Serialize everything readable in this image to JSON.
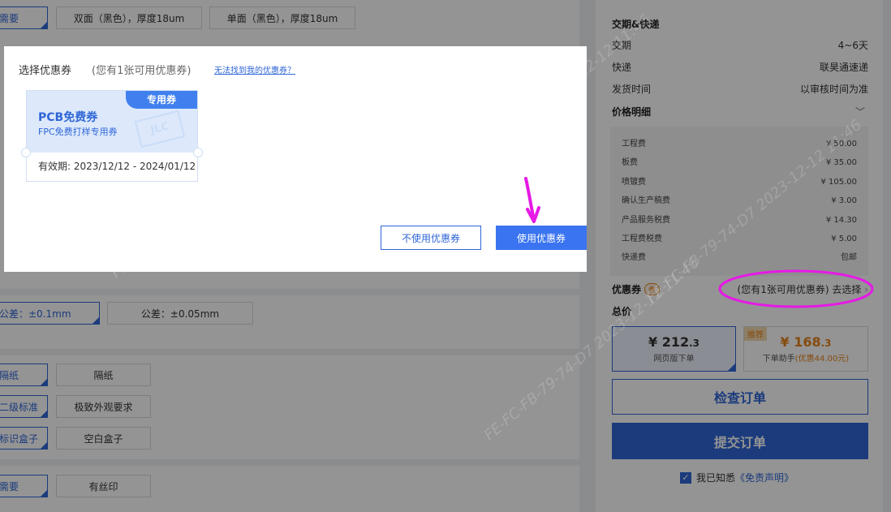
{
  "left": {
    "options": [
      {
        "label": "需要",
        "selected": true
      },
      {
        "label": "双面（黑色），厚度18um",
        "selected": false
      },
      {
        "label": "单面（黑色），厚度18um",
        "selected": false
      },
      {
        "label": "公差：±0.1mm",
        "selected": true
      },
      {
        "label": "公差：±0.05mm",
        "selected": false
      },
      {
        "label": "隔纸",
        "selected": true
      },
      {
        "label": "隔纸",
        "selected": false
      },
      {
        "label": "二级标准",
        "selected": true
      },
      {
        "label": "极致外观要求",
        "selected": false
      },
      {
        "label": "标识盒子",
        "selected": true
      },
      {
        "label": "空白盒子",
        "selected": false
      },
      {
        "label": "需要",
        "selected": true
      },
      {
        "label": "有丝印",
        "selected": false
      }
    ]
  },
  "sidebar": {
    "delivery_title": "交期&快递",
    "rows": [
      {
        "label": "交期",
        "value": "4~6天"
      },
      {
        "label": "快递",
        "value": "联昊通速递"
      },
      {
        "label": "发货时间",
        "value": "以审核时间为准"
      }
    ],
    "price_title": "价格明细",
    "price_items": [
      {
        "label": "工程费",
        "value": "¥ 50.00"
      },
      {
        "label": "板费",
        "value": "¥ 35.00"
      },
      {
        "label": "喷镀费",
        "value": "¥ 105.00"
      },
      {
        "label": "确认生产稿费",
        "value": "¥ 3.00"
      },
      {
        "label": "产品服务税费",
        "value": "¥ 14.30"
      },
      {
        "label": "工程费税费",
        "value": "¥ 5.00"
      },
      {
        "label": "快递费",
        "value": "包邮"
      }
    ],
    "coupon_label": "优惠券",
    "coupon_badge": "券",
    "coupon_choose": "(您有1张可用优惠券) 去选择",
    "total_label": "总价",
    "web_price_main": "¥ 212",
    "web_price_decimal": ".3",
    "web_price_desc": "网页版下单",
    "assist_badge": "推荐",
    "assist_price_main": "¥ 168",
    "assist_price_decimal": ".3",
    "assist_desc": "下单助手",
    "assist_discount": "(优惠44.00元)",
    "check_order": "检查订单",
    "submit_order": "提交订单",
    "agree_text": "我已知悉",
    "agree_link": "《免责声明》"
  },
  "dialog": {
    "title": "选择优惠券",
    "count": "(您有1张可用优惠券)",
    "help_link": "无法找到我的优惠券？",
    "coupon": {
      "tag": "专用券",
      "name": "PCB免费券",
      "desc": "FPC免费打样专用券",
      "logo": "JLC",
      "valid": "有效期: 2023/12/12 - 2024/01/12"
    },
    "no_use_button": "不使用优惠券",
    "use_button": "使用优惠券"
  },
  "watermark": "FE-FC-FB-79-74-D7  2023-12-12  11:46",
  "annotation_color": "#e619e6"
}
